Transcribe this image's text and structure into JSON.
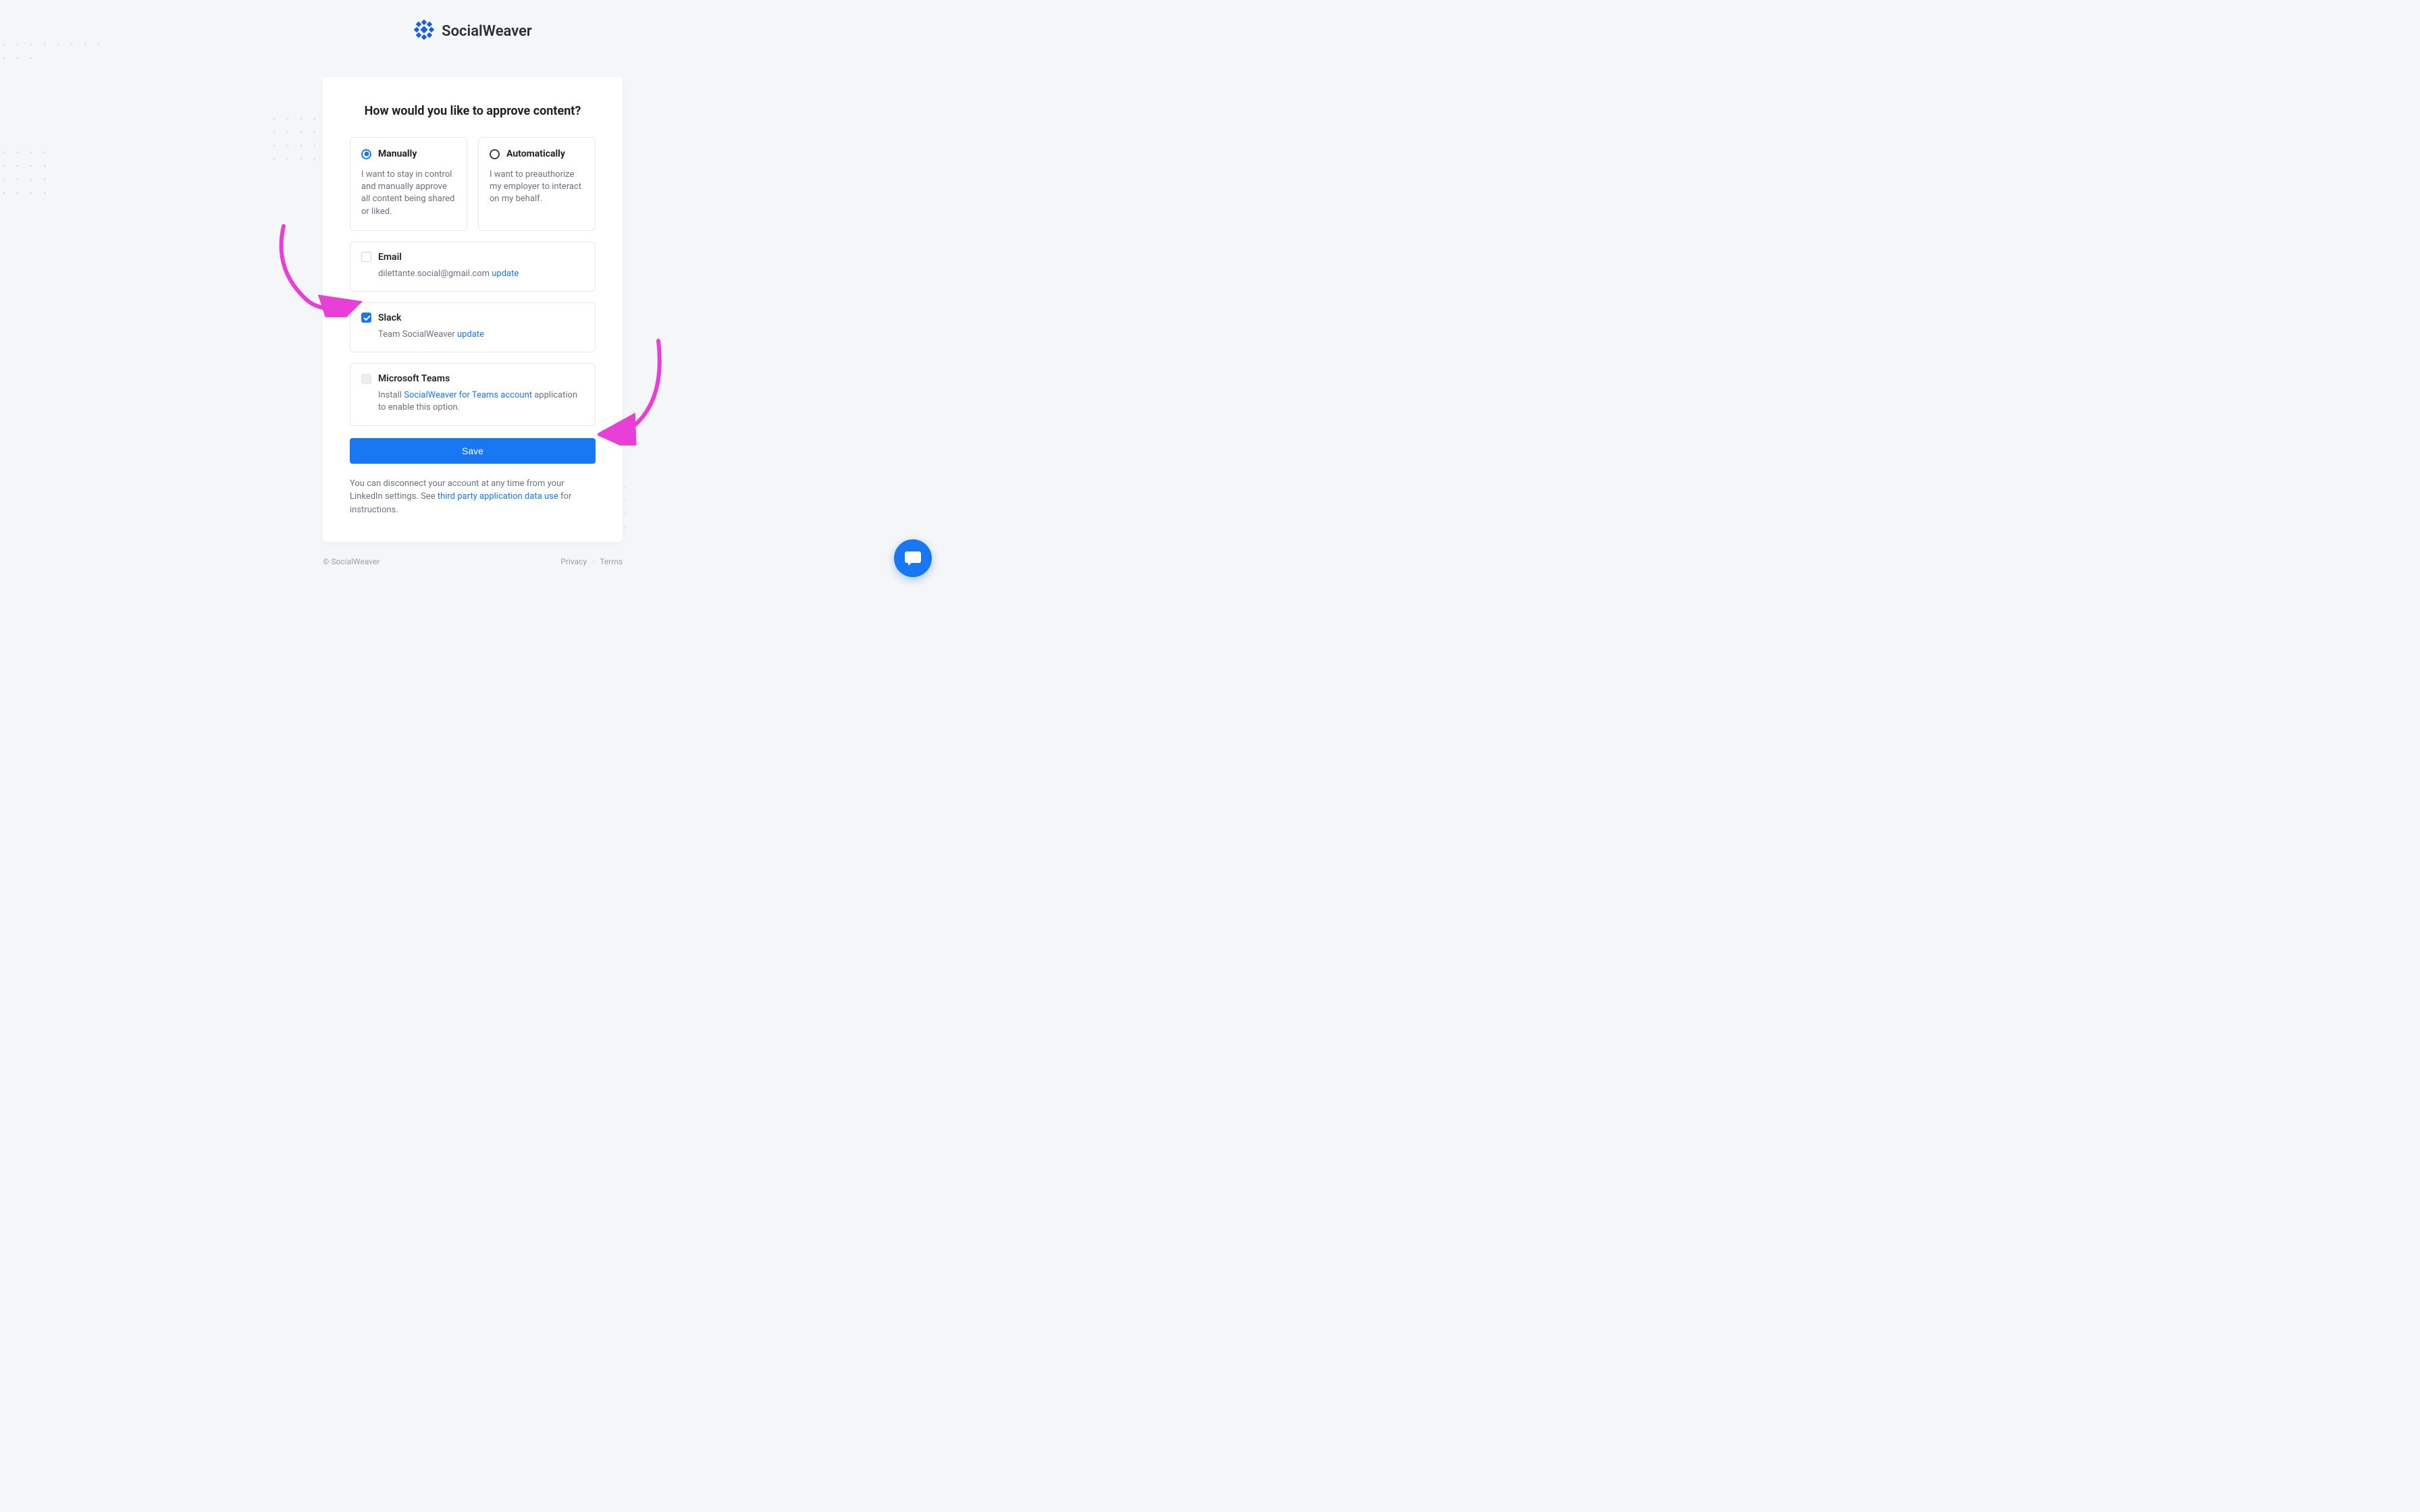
{
  "brand": "SocialWeaver",
  "colors": {
    "primary": "#1877f2",
    "annotation": "#e83fd8"
  },
  "card": {
    "title": "How would you like to approve content?",
    "options": {
      "manual": {
        "label": "Manually",
        "desc": "I want to stay in control and manually approve all content being shared or liked.",
        "selected": true
      },
      "auto": {
        "label": "Automatically",
        "desc": "I want to preauthorize my employer to interact on my behalf.",
        "selected": false
      }
    },
    "channels": {
      "email": {
        "label": "Email",
        "address": "dilettante.social@gmail.com",
        "update_link": "update",
        "checked": false
      },
      "slack": {
        "label": "Slack",
        "team_prefix": "Team ",
        "team_name": "SocialWeaver",
        "update_link": "update",
        "checked": true
      },
      "teams": {
        "label": "Microsoft Teams",
        "desc_prefix": "Install ",
        "link_text": "SocialWeaver for Teams account",
        "desc_suffix": " application to enable this option.",
        "checked": false,
        "disabled": true
      }
    },
    "save_label": "Save",
    "footnote_prefix": "You can disconnect your account at any time from your LinkedIn settings. See ",
    "footnote_link": "third party application data use",
    "footnote_suffix": " for instructions."
  },
  "footer": {
    "copyright": "© SocialWeaver",
    "privacy": "Privacy",
    "terms": "Terms"
  }
}
